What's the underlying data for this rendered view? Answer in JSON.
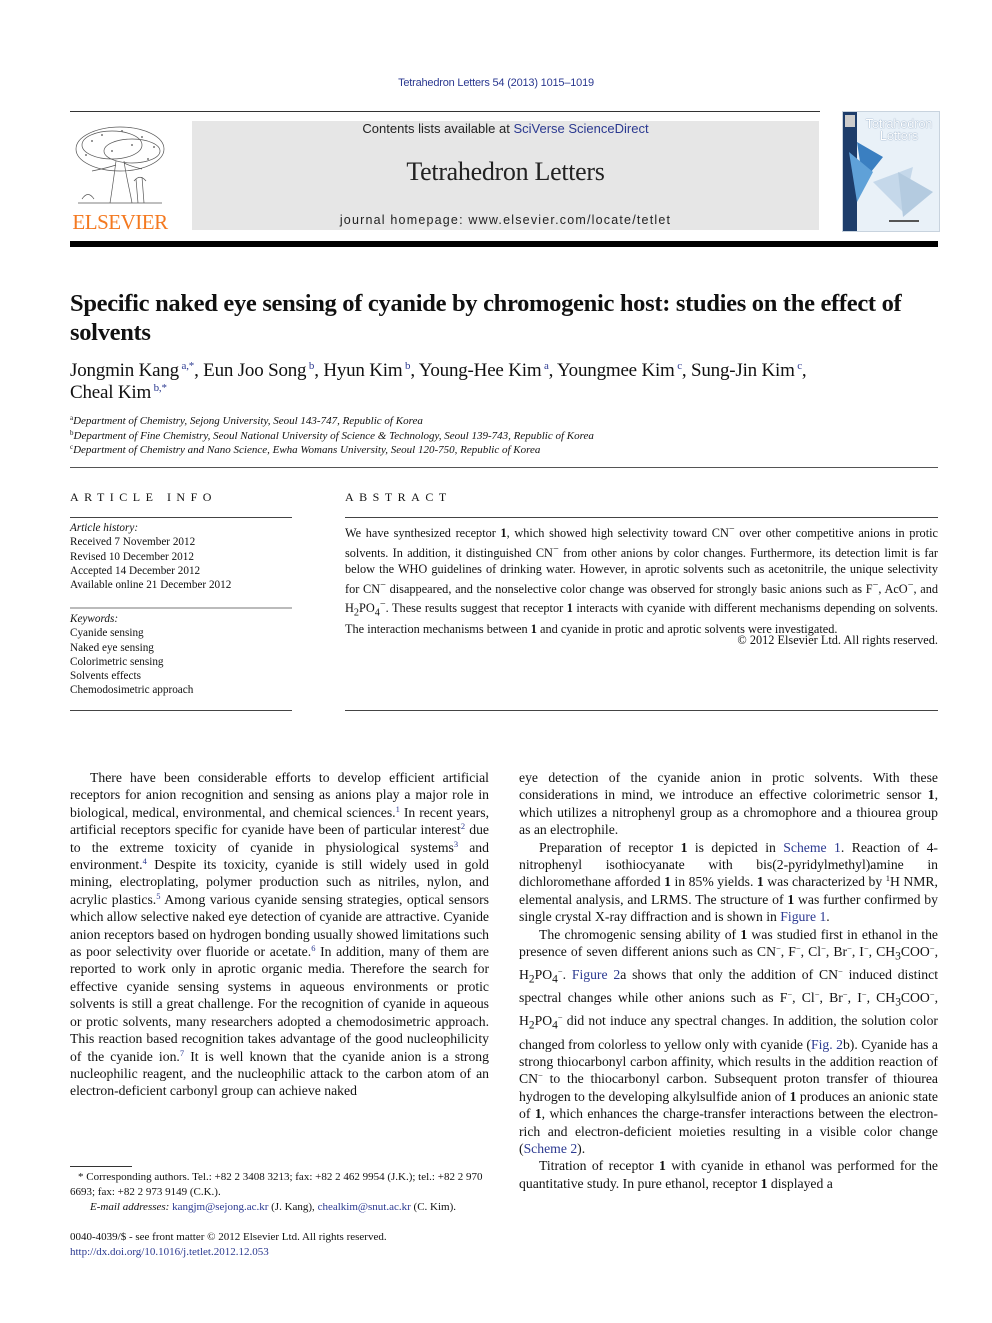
{
  "header": {
    "citation": "Tetrahedron Letters 54 (2013) 1015–1019",
    "contents_prefix": "Contents lists available at ",
    "contents_link": "SciVerse ScienceDirect",
    "journal_title": "Tetrahedron Letters",
    "homepage": "journal homepage: www.elsevier.com/locate/tetlet",
    "publisher_logo_text": "ELSEVIER",
    "cover_title_line1": "Tetrahedron",
    "cover_title_line2": "Letters",
    "colors": {
      "link": "#2b3990",
      "elsevier_orange": "#f47920",
      "masthead_bg": "#e6e6e6"
    }
  },
  "article": {
    "title": "Specific naked eye sensing of cyanide by chromogenic host: studies on the effect of solvents",
    "authors": [
      {
        "name": "Jongmin Kang",
        "sup": "a,*",
        "sep": ", "
      },
      {
        "name": "Eun Joo Song",
        "sup": "b",
        "sep": ", "
      },
      {
        "name": "Hyun Kim",
        "sup": "b",
        "sep": ", "
      },
      {
        "name": "Young-Hee Kim",
        "sup": "a",
        "sep": ", "
      },
      {
        "name": "Youngmee Kim",
        "sup": "c",
        "sep": ", "
      },
      {
        "name": "Sung-Jin Kim",
        "sup": "c",
        "sep": ", "
      },
      {
        "name": "Cheal Kim",
        "sup": "b,*",
        "sep": ""
      }
    ],
    "affiliations": [
      {
        "key": "a",
        "text": "Department of Chemistry, Sejong University, Seoul 143-747, Republic of Korea"
      },
      {
        "key": "b",
        "text": "Department of Fine Chemistry, Seoul National University of Science & Technology, Seoul 139-743, Republic of Korea"
      },
      {
        "key": "c",
        "text": "Department of Chemistry and Nano Science, Ewha Womans University, Seoul 120-750, Republic of Korea"
      }
    ]
  },
  "article_info": {
    "heading": "ARTICLE INFO",
    "history_label": "Article history:",
    "history": [
      "Received 7 November 2012",
      "Revised 10 December 2012",
      "Accepted 14 December 2012",
      "Available online 21 December 2012"
    ],
    "keywords_label": "Keywords:",
    "keywords": [
      "Cyanide sensing",
      "Naked eye sensing",
      "Colorimetric sensing",
      "Solvents effects",
      "Chemodosimetric approach"
    ]
  },
  "abstract": {
    "heading": "ABSTRACT",
    "html": "We have synthesized receptor <b>1</b>, which showed high selectivity toward CN<sup>−</sup> over other competitive anions in protic solvents. In addition, it distinguished CN<sup>−</sup> from other anions by color changes. Furthermore, its detection limit is far below the WHO guidelines of drinking water. However, in aprotic solvents such as acetonitrile, the unique selectivity for CN<sup>−</sup> disappeared, and the nonselective color change was observed for strongly basic anions such as F<sup>−</sup>, AcO<sup>−</sup>, and H<sub>2</sub>PO<sub>4</sub><sup>−</sup>. These results suggest that receptor <b>1</b> interacts with cyanide with different mechanisms depending on solvents. The interaction mechanisms between <b>1</b> and cyanide in protic and aprotic solvents were investigated.",
    "copyright": "© 2012 Elsevier Ltd. All rights reserved."
  },
  "body": {
    "left_column": [
      "There have been considerable efforts to develop efficient artificial receptors for anion recognition and sensing as anions play a major role in biological, medical, environmental, and chemical sciences.<sup class=\"ref\">1</sup> In recent years, artificial receptors specific for cyanide have been of particular interest<sup class=\"ref\">2</sup> due to the extreme toxicity of cyanide in physiological systems<sup class=\"ref\">3</sup> and environment.<sup class=\"ref\">4</sup> Despite its toxicity, cyanide is still widely used in gold mining, electroplating, polymer production such as nitriles, nylon, and acrylic plastics.<sup class=\"ref\">5</sup> Among various cyanide sensing strategies, optical sensors which allow selective naked eye detection of cyanide are attractive. Cyanide anion receptors based on hydrogen bonding usually showed limitations such as poor selectivity over fluoride or acetate.<sup class=\"ref\">6</sup> In addition, many of them are reported to work only in aprotic organic media. Therefore the search for effective cyanide sensing systems in aqueous environments or protic solvents is still a great challenge. For the recognition of cyanide in aqueous or protic solvents, many researchers adopted a chemodosimetric approach. This reaction based recognition takes advantage of the good nucleophilicity of the cyanide ion.<sup class=\"ref\">7</sup> It is well known that the cyanide anion is a strong nucleophilic reagent, and the nucleophilic attack to the carbon atom of an electron-deficient carbonyl group can achieve naked"
    ],
    "right_column": [
      "eye detection of the cyanide anion in protic solvents. With these considerations in mind, we introduce an effective colorimetric sensor <b>1</b>, which utilizes a nitrophenyl group as a chromophore and a thiourea group as an electrophile.",
      "Preparation of receptor <b>1</b> is depicted in <a class=\"link\">Scheme 1</a>. Reaction of 4-nitrophenyl isothiocyanate with bis(2-pyridylmethyl)amine in dichloromethane afforded <b>1</b> in 85% yields. <b>1</b> was characterized by <sup>1</sup>H NMR, elemental analysis, and LRMS. The structure of <b>1</b> was further confirmed by single crystal X-ray diffraction and is shown in <a class=\"link\">Figure 1</a>.",
      "The chromogenic sensing ability of <b>1</b> was studied first in ethanol in the presence of seven different anions such as CN<sup>−</sup>, F<sup>−</sup>, Cl<sup>−</sup>, Br<sup>−</sup>, I<sup>−</sup>, CH<sub>3</sub>COO<sup>−</sup>, H<sub>2</sub>PO<sub>4</sub><sup>−</sup>. <a class=\"link\">Figure 2</a>a shows that only the addition of CN<sup>−</sup> induced distinct spectral changes while other anions such as F<sup>−</sup>, Cl<sup>−</sup>, Br<sup>−</sup>, I<sup>−</sup>, CH<sub>3</sub>COO<sup>−</sup>, H<sub>2</sub>PO<sub>4</sub><sup>−</sup> did not induce any spectral changes. In addition, the solution color changed from colorless to yellow only with cyanide (<a class=\"link\">Fig. 2</a>b). Cyanide has a strong thiocarbonyl carbon affinity, which results in the addition reaction of CN<sup>−</sup> to the thiocarbonyl carbon. Subsequent proton transfer of thiourea hydrogen to the developing alkylsulfide anion of <b>1</b> produces an anionic state of <b>1</b>, which enhances the charge-transfer interactions between the electron-rich and electron-deficient moieties resulting in a visible color change (<a class=\"link\">Scheme 2</a>).",
      "Titration of receptor <b>1</b> with cyanide in ethanol was performed for the quantitative study. In pure ethanol, receptor <b>1</b> displayed a"
    ],
    "right_first_noindent": true
  },
  "footnotes": {
    "corresponding": "* Corresponding authors. Tel.: +82 2 3408 3213; fax: +82 2 462 9954 (J.K.); tel.: +82 2 970 6693; fax: +82 2 973 9149 (C.K.).",
    "email_label": "E-mail addresses:",
    "email1": "kangjm@sejong.ac.kr",
    "email1_owner": " (J. Kang), ",
    "email2": "chealkim@snut.ac.kr",
    "email2_owner": " (C. Kim).",
    "issn_line": "0040-4039/$ - see front matter © 2012 Elsevier Ltd. All rights reserved.",
    "doi": "http://dx.doi.org/10.1016/j.tetlet.2012.12.053"
  }
}
